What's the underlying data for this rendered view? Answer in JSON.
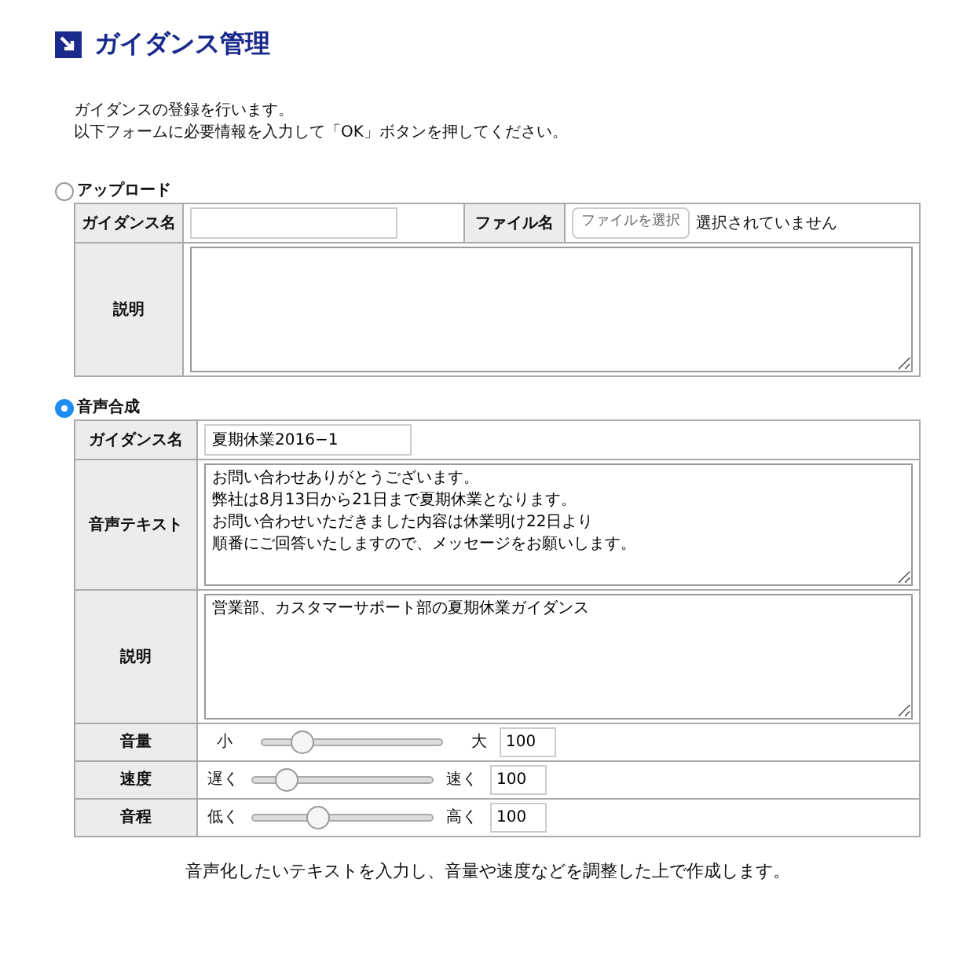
{
  "header": {
    "title": "ガイダンス管理"
  },
  "intro": [
    "ガイダンスの登録を行います。",
    "以下フォームに必要情報を入力して「OK」ボタンを押してください。"
  ],
  "upload": {
    "label": "アップロード",
    "selected": false,
    "name_label": "ガイダンス名",
    "file_label": "ファイル名",
    "file_button": "ファイルを選択",
    "file_status": "選択されていません",
    "description_label": "説明"
  },
  "synthesis": {
    "label": "音声合成",
    "selected": true,
    "name_label": "ガイダンス名",
    "name_value": "夏期休業2016−1",
    "text_label": "音声テキスト",
    "text_lines": [
      "お問い合わせありがとうございます。",
      "弊社は8月13日から21日まで夏期休業となります。",
      "お問い合わせいただきました内容は休業明け22日より",
      "順番にご回答いたしますので、メッセージをお願いします。"
    ],
    "description_label": "説明",
    "description_value": "営業部、カスタマーサポート部の夏期休業ガイダンス",
    "sliders": [
      {
        "label": "音量",
        "min_label": "小",
        "max_label": "大",
        "level": 0.22,
        "value": "100"
      },
      {
        "label": "速度",
        "min_label": "遅く",
        "max_label": "速く",
        "level": 0.19,
        "value": "100"
      },
      {
        "label": "音程",
        "min_label": "低く",
        "max_label": "高く",
        "level": 0.36,
        "value": "100"
      }
    ]
  },
  "footer": "音声化したいテキストを入力し、音量や速度などを調整した上で作成します。"
}
